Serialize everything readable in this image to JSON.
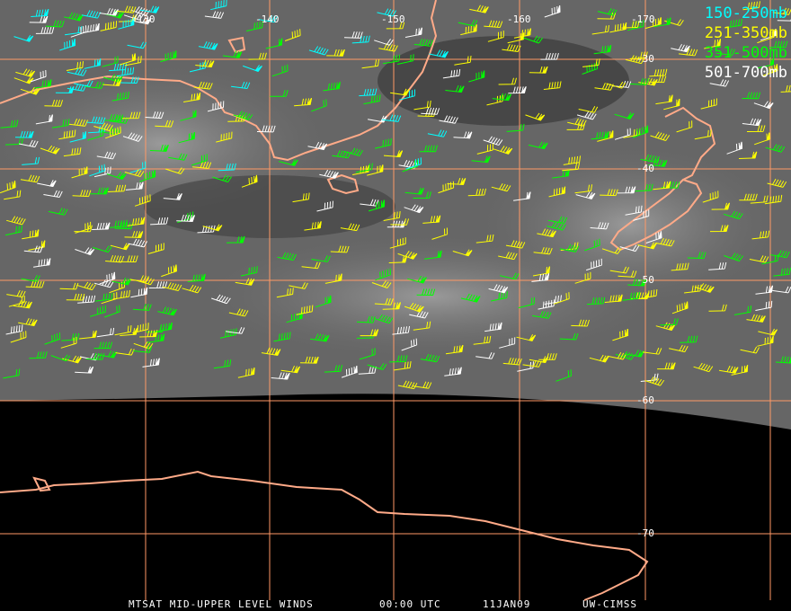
{
  "legend": [
    {
      "label": "150-250mb",
      "color": "#00ffff"
    },
    {
      "label": "251-350mb",
      "color": "#ffff00"
    },
    {
      "label": "351-500mb",
      "color": "#00ff00"
    },
    {
      "label": "501-700mb",
      "color": "#ffffff"
    }
  ],
  "longitude_labels": [
    "-130",
    "-140",
    "-150",
    "-160",
    "-170"
  ],
  "latitude_labels": [
    "-30",
    "-40",
    "-50",
    "-60",
    "-70"
  ],
  "caption": {
    "product": "MTSAT MID-UPPER LEVEL WINDS",
    "time": "00:00 UTC",
    "date": "11JAN09",
    "source": "UW-CIMSS"
  },
  "colors": {
    "grid": "#ff9966",
    "coast": "#ffaa88",
    "background_cloud": "#5a5a5a"
  }
}
